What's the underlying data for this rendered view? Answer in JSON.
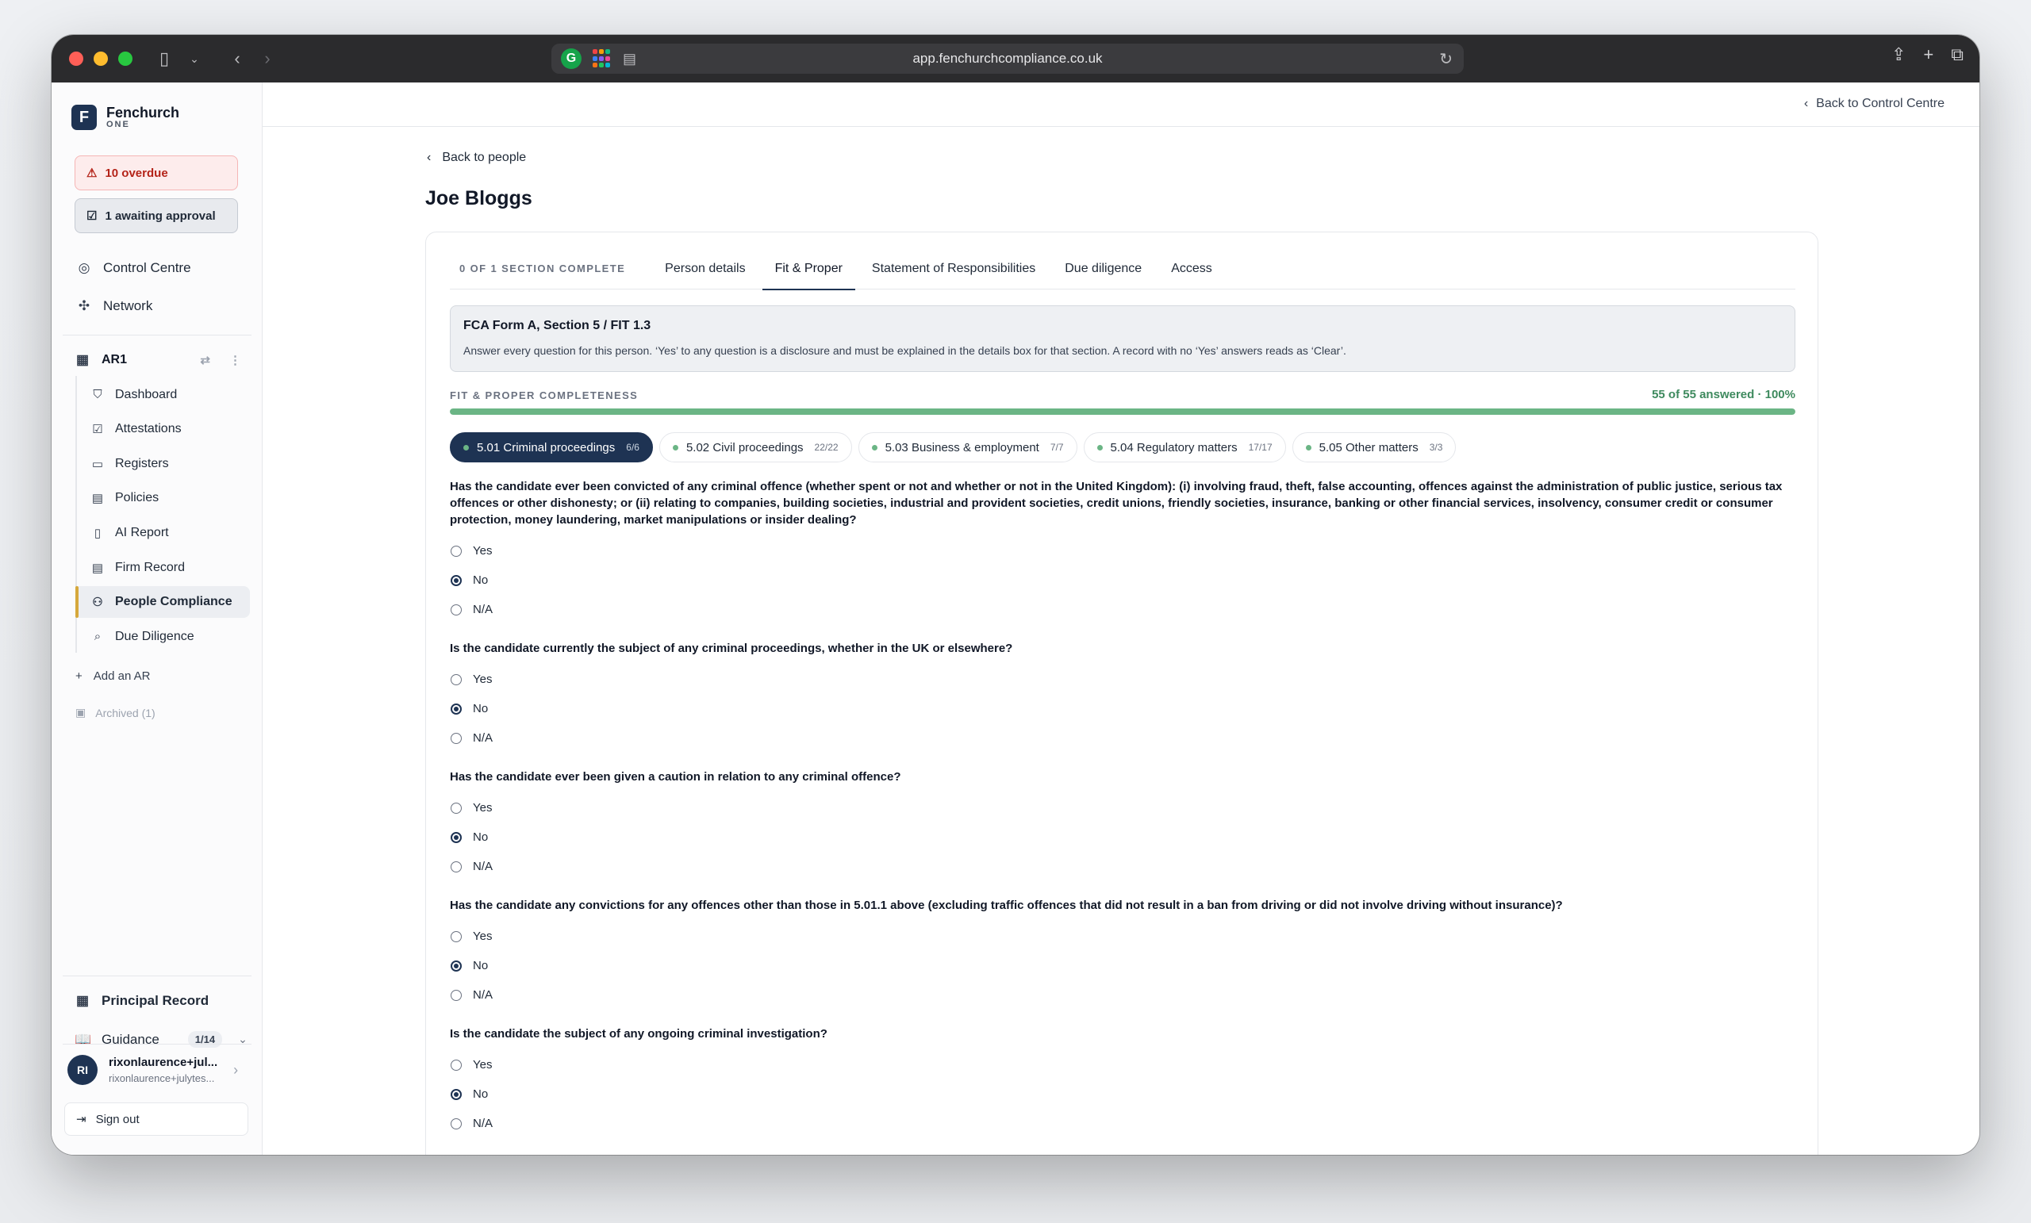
{
  "browser": {
    "url": "app.fenchurchcompliance.co.uk"
  },
  "sidebar": {
    "brand_name": "Fenchurch",
    "brand_sub": "ONE",
    "overdue_label": "10 overdue",
    "approval_label": "1 awaiting approval",
    "top_nav": [
      {
        "label": "Control Centre",
        "icon": "compass-icon"
      },
      {
        "label": "Network",
        "icon": "network-icon"
      }
    ],
    "ar_label": "AR1",
    "sub_nav": [
      {
        "label": "Dashboard",
        "icon": "shield-check-icon"
      },
      {
        "label": "Attestations",
        "icon": "checkbox-icon"
      },
      {
        "label": "Registers",
        "icon": "book-icon"
      },
      {
        "label": "Policies",
        "icon": "document-icon"
      },
      {
        "label": "AI Report",
        "icon": "file-icon"
      },
      {
        "label": "Firm Record",
        "icon": "file-text-icon"
      },
      {
        "label": "People Compliance",
        "icon": "users-icon",
        "active": true
      },
      {
        "label": "Due Diligence",
        "icon": "search-icon"
      }
    ],
    "add_ar_label": "Add an AR",
    "archived_label": "Archived (1)",
    "principal_record_label": "Principal Record",
    "guidance_label": "Guidance",
    "guidance_count": "1/14",
    "user_initials": "RI",
    "user_name": "rixonlaurence+jul...",
    "user_email": "rixonlaurence+julytes...",
    "signout_label": "Sign out"
  },
  "header": {
    "back_control_centre": "Back to Control Centre"
  },
  "main": {
    "back_people": "Back to people",
    "person_name": "Joe Bloggs",
    "section_status": "0 OF 1 SECTION COMPLETE",
    "tabs": [
      {
        "label": "Person details"
      },
      {
        "label": "Fit & Proper",
        "active": true
      },
      {
        "label": "Statement of Responsibilities"
      },
      {
        "label": "Due diligence"
      },
      {
        "label": "Access"
      }
    ],
    "info_title": "FCA Form A, Section 5 / FIT 1.3",
    "info_text": "Answer every question for this person. ‘Yes’ to any question is a disclosure and must be explained in the details box for that section. A record with no ‘Yes’ answers reads as ‘Clear’.",
    "completeness_label": "FIT & PROPER COMPLETENESS",
    "completeness_count": "55 of 55 answered · 100%",
    "completeness_percent": 100,
    "chips": [
      {
        "label": "5.01 Criminal proceedings",
        "count": "6/6",
        "active": true
      },
      {
        "label": "5.02 Civil proceedings",
        "count": "22/22"
      },
      {
        "label": "5.03 Business & employment",
        "count": "7/7"
      },
      {
        "label": "5.04 Regulatory matters",
        "count": "17/17"
      },
      {
        "label": "5.05 Other matters",
        "count": "3/3"
      }
    ],
    "options": [
      "Yes",
      "No",
      "N/A"
    ],
    "questions": [
      {
        "text": "Has the candidate ever been convicted of any criminal offence (whether spent or not and whether or not in the United Kingdom): (i) involving fraud, theft, false accounting, offences against the administration of public justice, serious tax offences or other dishonesty; or (ii) relating to companies, building societies, industrial and provident societies, credit unions, friendly societies, insurance, banking or other financial services, insolvency, consumer credit or consumer protection, money laundering, market manipulations or insider dealing?",
        "selected": "No"
      },
      {
        "text": "Is the candidate currently the subject of any criminal proceedings, whether in the UK or elsewhere?",
        "selected": "No"
      },
      {
        "text": "Has the candidate ever been given a caution in relation to any criminal offence?",
        "selected": "No"
      },
      {
        "text": "Has the candidate any convictions for any offences other than those in 5.01.1 above (excluding traffic offences that did not result in a ban from driving or did not involve driving without insurance)?",
        "selected": "No"
      },
      {
        "text": "Is the candidate the subject of any ongoing criminal investigation?",
        "selected": "No"
      }
    ]
  }
}
